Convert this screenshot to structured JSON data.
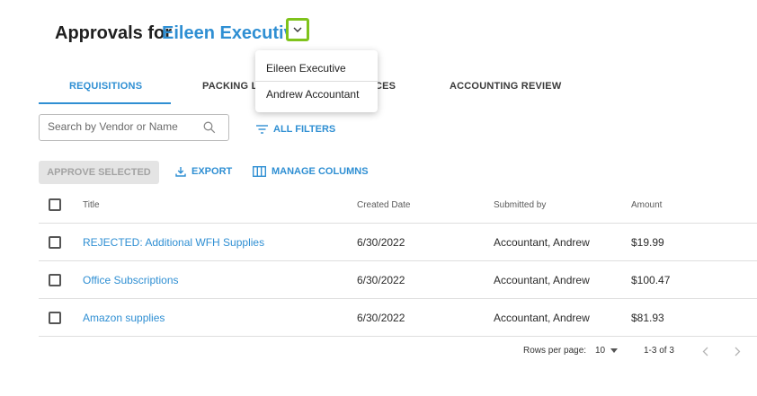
{
  "header": {
    "title_prefix": "Approvals for",
    "selected_user": "Eileen Executive",
    "dropdown_icon": "chevron-down-icon"
  },
  "tabs": [
    {
      "label": "REQUISITIONS",
      "active": true
    },
    {
      "label": "PACKING L",
      "active": false
    },
    {
      "label": "CES",
      "active": false
    },
    {
      "label": "ACCOUNTING REVIEW",
      "active": false
    }
  ],
  "search": {
    "placeholder": "Search by Vendor or Name",
    "icon": "search-icon"
  },
  "filters": {
    "label": "ALL FILTERS",
    "icon": "filter-icon"
  },
  "toolbar": {
    "approve_label": "APPROVE SELECTED",
    "export_label": "EXPORT",
    "export_icon": "download-icon",
    "columns_label": "MANAGE COLUMNS",
    "columns_icon": "columns-icon"
  },
  "table": {
    "headers": [
      "Title",
      "Created Date",
      "Submitted by",
      "Amount"
    ],
    "rows": [
      {
        "title": "REJECTED: Additional WFH Supplies",
        "date": "6/30/2022",
        "submitted_by": "Accountant, Andrew",
        "amount": "$19.99"
      },
      {
        "title": "Office Subscriptions",
        "date": "6/30/2022",
        "submitted_by": "Accountant, Andrew",
        "amount": "$100.47"
      },
      {
        "title": "Amazon supplies",
        "date": "6/30/2022",
        "submitted_by": "Accountant, Andrew",
        "amount": "$81.93"
      }
    ]
  },
  "pagination": {
    "rows_per_page_label": "Rows per page:",
    "rows_per_page": "10",
    "range": "1-3 of 3"
  },
  "user_dropdown": {
    "options": [
      "Eileen Executive",
      "Andrew Accountant"
    ]
  },
  "colors": {
    "accent": "#2f8fd3",
    "highlight": "#7fc31c"
  }
}
